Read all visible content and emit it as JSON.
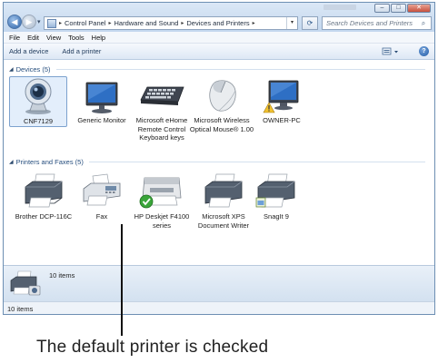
{
  "window": {
    "controls": {
      "minimize": "–",
      "maximize": "□",
      "close": "✕"
    }
  },
  "nav": {
    "back_icon": "arrow-left",
    "forward_icon": "arrow-right",
    "breadcrumbs": [
      "Control Panel",
      "Hardware and Sound",
      "Devices and Printers"
    ],
    "search_placeholder": "Search Devices and Printers"
  },
  "menu": [
    "File",
    "Edit",
    "View",
    "Tools",
    "Help"
  ],
  "commands": {
    "add_device": "Add a device",
    "add_printer": "Add a printer"
  },
  "groups": {
    "devices": {
      "title": "Devices (5)",
      "items": [
        {
          "label": "CNF7129",
          "icon": "webcam-icon"
        },
        {
          "label": "Generic Monitor",
          "icon": "monitor-icon"
        },
        {
          "label": "Microsoft eHome Remote Control Keyboard keys",
          "icon": "keyboard-icon"
        },
        {
          "label": "Microsoft Wireless Optical Mouse® 1.00",
          "icon": "mouse-icon"
        },
        {
          "label": "OWNER-PC",
          "icon": "computer-icon"
        }
      ]
    },
    "printers": {
      "title": "Printers and Faxes (5)",
      "items": [
        {
          "label": "Brother DCP-116C",
          "icon": "printer-icon"
        },
        {
          "label": "Fax",
          "icon": "fax-icon"
        },
        {
          "label": "HP Deskjet F4100 series",
          "icon": "printer-icon",
          "default": true
        },
        {
          "label": "Microsoft XPS Document Writer",
          "icon": "printer-icon"
        },
        {
          "label": "SnagIt 9",
          "icon": "printer-icon"
        }
      ]
    }
  },
  "details": {
    "count": "10 items"
  },
  "status": {
    "text": "10 items"
  },
  "caption": "The default printer is checked",
  "colors": {
    "accent": "#264e7e",
    "default_check": "#3aa53a",
    "warning": "#f2c230"
  }
}
